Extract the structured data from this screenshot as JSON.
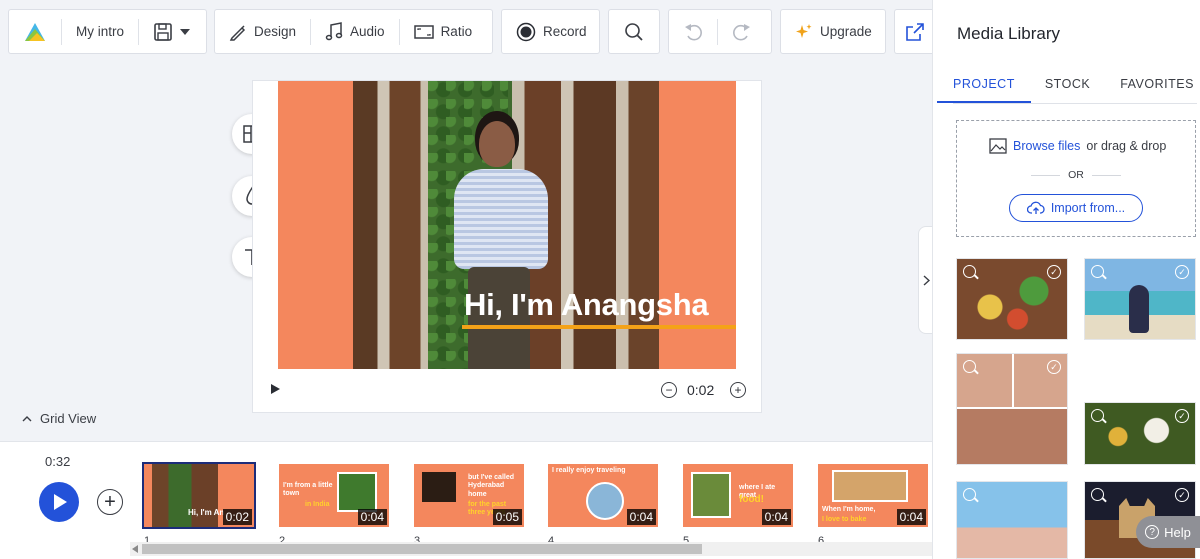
{
  "toolbar": {
    "project_name": "My intro",
    "design_label": "Design",
    "audio_label": "Audio",
    "ratio_label": "Ratio",
    "record_label": "Record",
    "upgrade_label": "Upgrade"
  },
  "canvas": {
    "caption": "Hi, I'm Anangsha",
    "current_time": "0:02",
    "zoom_out": "−",
    "zoom_in": "+"
  },
  "grid_view": {
    "label": "Grid View"
  },
  "timeline": {
    "total_time": "0:32",
    "add": "+",
    "scenes": [
      {
        "number": "1",
        "duration": "0:02",
        "text": "Hi, I'm An"
      },
      {
        "number": "2",
        "duration": "0:04",
        "text": "I'm from a little town",
        "highlight": "in India"
      },
      {
        "number": "3",
        "duration": "0:05",
        "text": "but I've called Hyderabad home",
        "highlight": "for the past three years"
      },
      {
        "number": "4",
        "duration": "0:04",
        "text": "I really enjoy traveling"
      },
      {
        "number": "5",
        "duration": "0:04",
        "text": "where I ate great",
        "highlight": "food!"
      },
      {
        "number": "6",
        "duration": "0:04",
        "text": "When I'm home,",
        "highlight": "I love to bake"
      }
    ]
  },
  "media_library": {
    "title": "Media Library",
    "tabs": [
      "PROJECT",
      "STOCK",
      "FAVORITES"
    ],
    "browse_link": "Browse files",
    "browse_rest": "or drag & drop",
    "or": "OR",
    "import_label": "Import from..."
  },
  "help": {
    "label": "Help",
    "icon": "?"
  },
  "colors": {
    "accent": "#2352d9",
    "scene_bg": "#f4875d",
    "caption_underline": "#f4a218"
  }
}
